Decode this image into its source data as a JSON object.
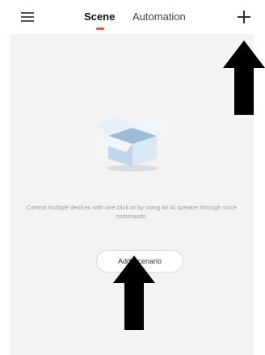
{
  "header": {
    "menu_icon": "hamburger-menu-icon",
    "tabs": [
      {
        "label": "Scene",
        "active": true
      },
      {
        "label": "Automation",
        "active": false
      }
    ],
    "add_icon": "plus-icon"
  },
  "empty_state": {
    "illustration": "open-box-icon",
    "message": "Control multiple devices with one click or by using an AI speaker through voice commands.",
    "button_label": "Add Scenario"
  },
  "annotations": {
    "arrow_icon": "up-arrow-icon"
  },
  "colors": {
    "accent": "#f05a1c",
    "background": "#f3f3f3",
    "arrow": "#000000"
  }
}
